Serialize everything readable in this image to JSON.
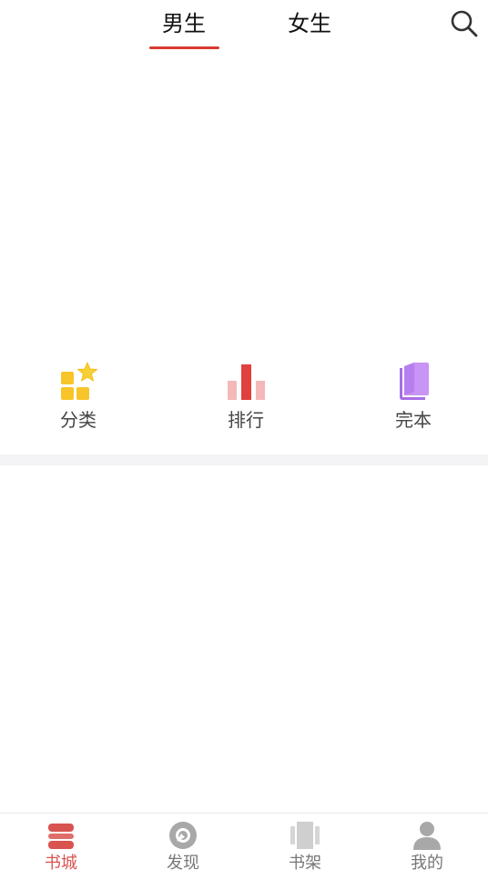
{
  "header": {
    "tabs": [
      {
        "label": "男生",
        "active": true
      },
      {
        "label": "女生",
        "active": false
      }
    ],
    "search_icon": "search-icon",
    "accent_color": "#d83a33"
  },
  "quick_entries": [
    {
      "label": "分类",
      "icon": "category-icon",
      "color": "#f7c52a"
    },
    {
      "label": "排行",
      "icon": "ranking-icon",
      "color": "#e0413c"
    },
    {
      "label": "完本",
      "icon": "completed-books-icon",
      "color": "#b77ef0"
    }
  ],
  "bottom_nav": {
    "items": [
      {
        "label": "书城",
        "icon": "bookstore-icon",
        "active": true
      },
      {
        "label": "发现",
        "icon": "discover-icon",
        "active": false
      },
      {
        "label": "书架",
        "icon": "bookshelf-icon",
        "active": false
      },
      {
        "label": "我的",
        "icon": "profile-icon",
        "active": false
      }
    ],
    "active_color": "#d9534f",
    "inactive_color": "#777777"
  }
}
